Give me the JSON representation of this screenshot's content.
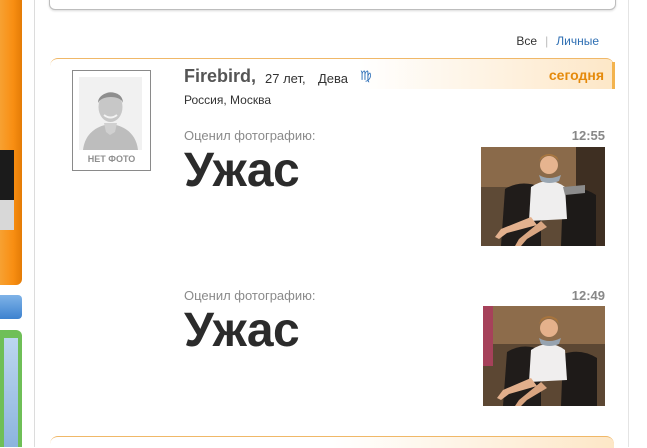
{
  "filter": {
    "all_label": "Все",
    "separator": "|",
    "personal_label": "Личные"
  },
  "entry": {
    "date": "сегодня",
    "user": {
      "name": "Firebird,",
      "age": "27 лет,",
      "sign": "Дева",
      "zodiac_symbol": "♍",
      "location": "Россия, Москва",
      "avatar_label": "НЕТ ФОТО"
    },
    "activities": [
      {
        "label": "Оценил фотографию:",
        "time": "12:55",
        "rating": "Ужас"
      },
      {
        "label": "Оценил фотографию:",
        "time": "12:49",
        "rating": "Ужас"
      }
    ]
  },
  "colors": {
    "accent_orange": "#e58a0b",
    "link_blue": "#2f6fb3",
    "header_gradient": "#fde7c7"
  }
}
